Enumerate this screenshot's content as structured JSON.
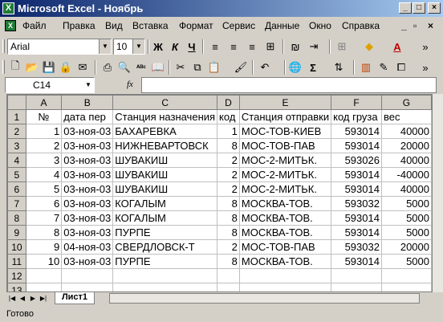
{
  "app": {
    "title": "Microsoft Excel - Ноябрь",
    "logo": "X"
  },
  "window_controls": [
    "_",
    "□",
    "×"
  ],
  "menu": {
    "items": [
      "Файл",
      "Правка",
      "Вид",
      "Вставка",
      "Формат",
      "Сервис",
      "Данные",
      "Окно",
      "Справка"
    ],
    "right_icons": [
      "_",
      "▫",
      "×"
    ]
  },
  "format_toolbar": {
    "font": "Arial",
    "size": "10",
    "bold": "Ж",
    "italic": "К",
    "underline": "Ч"
  },
  "formula_bar": {
    "name_box": "C14",
    "fx": "fx",
    "value": ""
  },
  "sheet": {
    "columns": [
      "A",
      "B",
      "C",
      "D",
      "E",
      "F",
      "G"
    ],
    "rows": [
      [
        "№",
        "дата пер",
        "Станция назначения",
        "код",
        "Станция отправки",
        "код груза",
        "вес"
      ],
      [
        "1",
        "03-ноя-03",
        "БАХАРЕВКА",
        "1",
        "МОС-ТОВ-КИЕВ",
        "593014",
        "40000"
      ],
      [
        "2",
        "03-ноя-03",
        "НИЖНЕВАРТОВСК",
        "8",
        "МОС-ТОВ-ПАВ",
        "593014",
        "20000"
      ],
      [
        "3",
        "03-ноя-03",
        "ШУВАКИШ",
        "2",
        "МОС-2-МИТЬК.",
        "593026",
        "40000"
      ],
      [
        "4",
        "03-ноя-03",
        "ШУВАКИШ",
        "2",
        "МОС-2-МИТЬК.",
        "593014",
        "-40000"
      ],
      [
        "5",
        "03-ноя-03",
        "ШУВАКИШ",
        "2",
        "МОС-2-МИТЬК.",
        "593014",
        "40000"
      ],
      [
        "6",
        "03-ноя-03",
        "КОГАЛЫМ",
        "8",
        "МОСКВА-ТОВ.",
        "593032",
        "5000"
      ],
      [
        "7",
        "03-ноя-03",
        "КОГАЛЫМ",
        "8",
        "МОСКВА-ТОВ.",
        "593014",
        "5000"
      ],
      [
        "8",
        "03-ноя-03",
        "ПУРПЕ",
        "8",
        "МОСКВА-ТОВ.",
        "593014",
        "5000"
      ],
      [
        "9",
        "04-ноя-03",
        "СВЕРДЛОВСК-Т",
        "2",
        "МОС-ТОВ-ПАВ",
        "593032",
        "20000"
      ],
      [
        "10",
        "03-ноя-03",
        "ПУРПЕ",
        "8",
        "МОСКВА-ТОВ.",
        "593014",
        "5000"
      ],
      [
        "",
        "",
        "",
        "",
        "",
        "",
        ""
      ],
      [
        "",
        "",
        "",
        "",
        "",
        "",
        ""
      ],
      [
        "",
        "",
        "",
        "",
        "",
        "",
        ""
      ]
    ],
    "row_numbers": [
      "1",
      "2",
      "3",
      "4",
      "5",
      "6",
      "7",
      "8",
      "9",
      "10",
      "11",
      "12",
      "13"
    ]
  },
  "tabs": {
    "active": "Лист1"
  },
  "status": {
    "text": "Готово"
  }
}
